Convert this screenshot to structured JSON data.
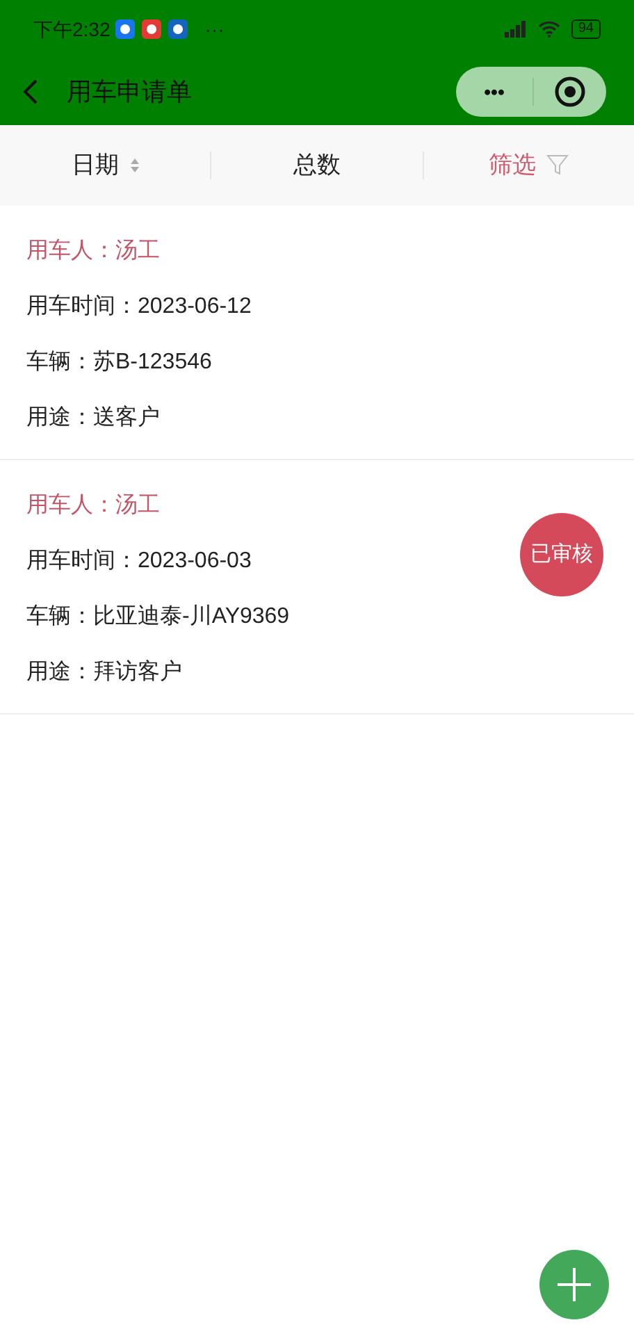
{
  "status_bar": {
    "time": "下午2:32",
    "more": "···",
    "battery": "94"
  },
  "nav": {
    "title": "用车申请单",
    "capsule_more": "•••"
  },
  "filter_bar": [
    {
      "label": "日期",
      "kind": "sort",
      "selected": false
    },
    {
      "label": "总数",
      "kind": "plain",
      "selected": false
    },
    {
      "label": "筛选",
      "kind": "filter",
      "selected": true
    }
  ],
  "requests": [
    {
      "applicant": "用车人：汤工",
      "time": "用车时间：2023-06-12",
      "vehicle": "车辆：苏B-123546",
      "purpose": "用途：送客户"
    },
    {
      "applicant": "用车人：汤工",
      "time": "用车时间：2023-06-03",
      "vehicle": "车辆：比亚迪泰-川AY9369",
      "purpose": "用途：拜访客户",
      "badge": "已审核"
    }
  ]
}
